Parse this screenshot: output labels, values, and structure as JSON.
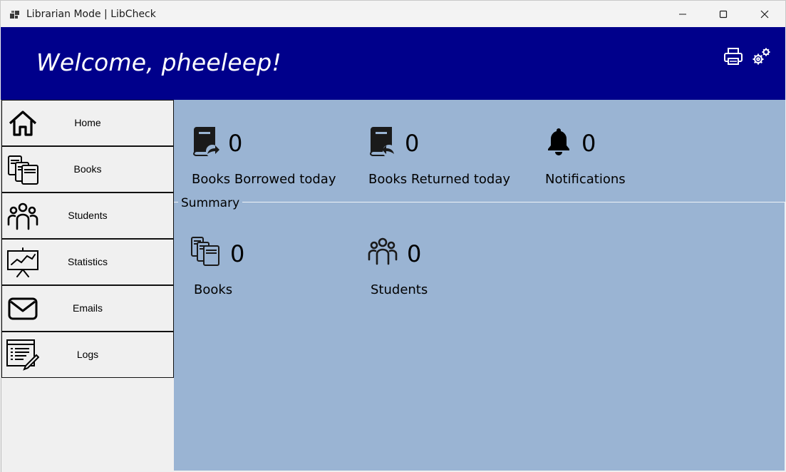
{
  "window": {
    "title": "Librarian Mode | LibCheck",
    "controls": [
      "minimize-icon",
      "maximize-icon",
      "close-icon"
    ]
  },
  "header": {
    "welcome": "Welcome, pheeleep!",
    "background_color": "#00008b",
    "actions": [
      "printer-icon",
      "gears-icon"
    ]
  },
  "sidebar": {
    "items": [
      {
        "label": "Home",
        "icon": "home-icon"
      },
      {
        "label": "Books",
        "icon": "books-icon"
      },
      {
        "label": "Students",
        "icon": "students-icon"
      },
      {
        "label": "Statistics",
        "icon": "statistics-icon"
      },
      {
        "label": "Emails",
        "icon": "email-icon"
      },
      {
        "label": "Logs",
        "icon": "logs-icon"
      }
    ]
  },
  "main": {
    "background_color": "#9ab4d3",
    "today": [
      {
        "value": "0",
        "label": "Books Borrowed today",
        "icon": "book-borrow-icon"
      },
      {
        "value": "0",
        "label": "Books Returned today",
        "icon": "book-return-icon"
      },
      {
        "value": "0",
        "label": "Notifications",
        "icon": "bell-icon"
      }
    ],
    "summary": {
      "legend": "Summary",
      "items": [
        {
          "value": "0",
          "label": "Books",
          "icon": "books-icon"
        },
        {
          "value": "0",
          "label": "Students",
          "icon": "students-icon"
        }
      ]
    }
  }
}
